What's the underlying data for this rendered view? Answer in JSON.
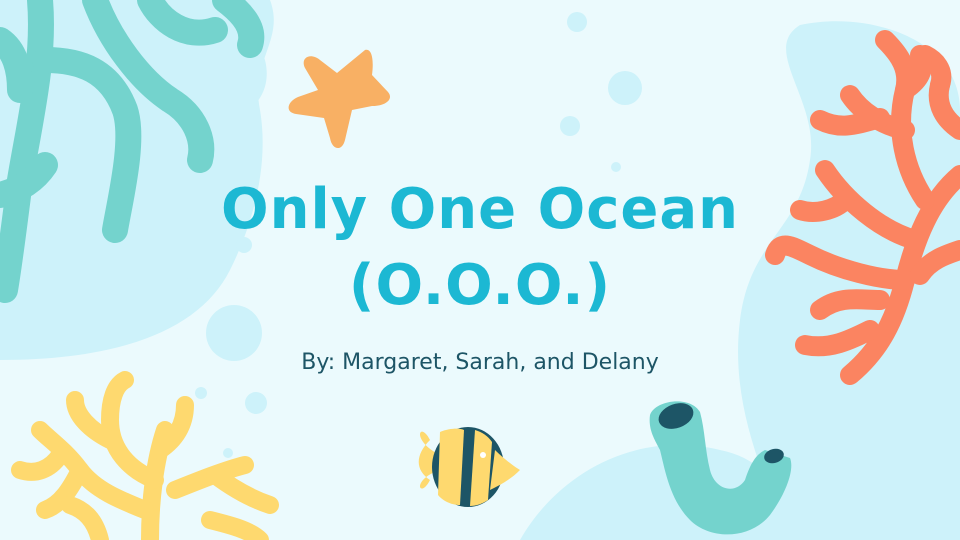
{
  "slide": {
    "title_line1": "Only One Ocean",
    "title_line2": "(O.O.O.)",
    "byline": "By: Margaret, Sarah, and Delany"
  },
  "colors": {
    "background": "#ebfafd",
    "blob": "#cdf2fa",
    "title": "#1cb8d3",
    "byline": "#1d5566",
    "teal_coral": "#74d3cd",
    "orange_coral": "#fb8461",
    "yellow_coral": "#fed96f",
    "starfish": "#f8b064",
    "fish_dark": "#1d5566",
    "fish_yellow": "#fed96f"
  },
  "icons": [
    "teal-coral-icon",
    "starfish-icon",
    "orange-coral-icon",
    "yellow-coral-icon",
    "fish-icon",
    "tube-sponge-icon",
    "bubble-icon"
  ]
}
